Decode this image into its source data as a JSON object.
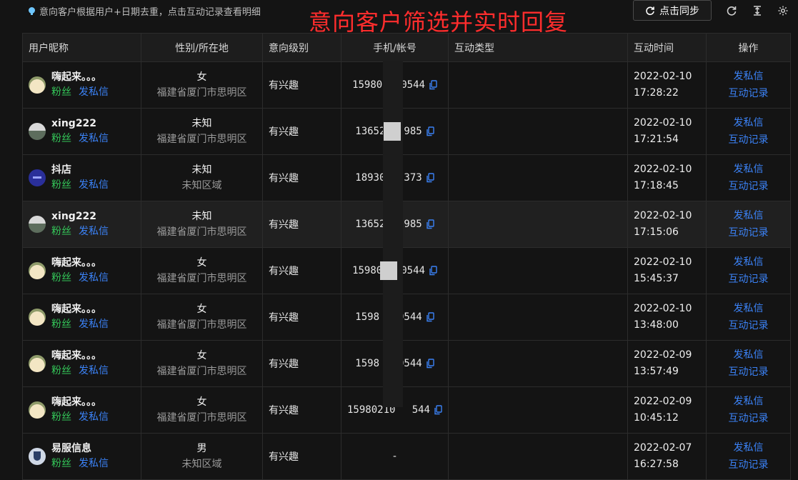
{
  "toolbar": {
    "hint": "意向客户根据用户+日期去重，点击互动记录查看明细",
    "overlay_title": "意向客户筛选并实时回复",
    "sync_label": "点击同步",
    "icons": [
      "refresh-icon",
      "column-height-icon",
      "gear-icon"
    ]
  },
  "table": {
    "headers": {
      "nickname": "用户昵称",
      "gender_region": "性别/所在地",
      "intent_level": "意向级别",
      "phone": "手机/帐号",
      "interaction_type": "互动类型",
      "interaction_time": "互动时间",
      "actions": "操作"
    },
    "rows": [
      {
        "nickname": "嗨起来。。。",
        "tag": "粉丝",
        "dm": "发私信",
        "gender": "女",
        "region": "福建省厦门市思明区",
        "level": "有兴趣",
        "phone_left": "15980",
        "phone_right": "0544",
        "type": "",
        "date": "2022-02-10",
        "time": "17:28:22",
        "op1": "发私信",
        "op2": "互动记录",
        "avatar": "totoro"
      },
      {
        "nickname": "xing222",
        "tag": "粉丝",
        "dm": "发私信",
        "gender": "未知",
        "region": "福建省厦门市思明区",
        "level": "有兴趣",
        "phone_left": "13652",
        "phone_right": "985",
        "type": "",
        "date": "2022-02-10",
        "time": "17:21:54",
        "op1": "发私信",
        "op2": "互动记录",
        "avatar": "landscape"
      },
      {
        "nickname": "抖店",
        "tag": "粉丝",
        "dm": "发私信",
        "gender": "未知",
        "region": "未知区域",
        "level": "有兴趣",
        "phone_left": "18930",
        "phone_right": "373",
        "type": "",
        "date": "2022-02-10",
        "time": "17:18:45",
        "op1": "发私信",
        "op2": "互动记录",
        "avatar": "store"
      },
      {
        "nickname": "xing222",
        "tag": "粉丝",
        "dm": "发私信",
        "gender": "未知",
        "region": "福建省厦门市思明区",
        "level": "有兴趣",
        "phone_left": "13652",
        "phone_right": "985",
        "type": "",
        "date": "2022-02-10",
        "time": "17:15:06",
        "op1": "发私信",
        "op2": "互动记录",
        "avatar": "landscape"
      },
      {
        "nickname": "嗨起来。。。",
        "tag": "粉丝",
        "dm": "发私信",
        "gender": "女",
        "region": "福建省厦门市思明区",
        "level": "有兴趣",
        "phone_left": "15980",
        "phone_right": "0544",
        "type": "",
        "date": "2022-02-10",
        "time": "15:45:37",
        "op1": "发私信",
        "op2": "互动记录",
        "avatar": "totoro"
      },
      {
        "nickname": "嗨起来。。。",
        "tag": "粉丝",
        "dm": "发私信",
        "gender": "女",
        "region": "福建省厦门市思明区",
        "level": "有兴趣",
        "phone_left": "1598",
        "phone_right": "0544",
        "type": "",
        "date": "2022-02-10",
        "time": "13:48:00",
        "op1": "发私信",
        "op2": "互动记录",
        "avatar": "totoro"
      },
      {
        "nickname": "嗨起来。。。",
        "tag": "粉丝",
        "dm": "发私信",
        "gender": "女",
        "region": "福建省厦门市思明区",
        "level": "有兴趣",
        "phone_left": "1598",
        "phone_right": "0544",
        "type": "",
        "date": "2022-02-09",
        "time": "13:57:49",
        "op1": "发私信",
        "op2": "互动记录",
        "avatar": "totoro"
      },
      {
        "nickname": "嗨起来。。。",
        "tag": "粉丝",
        "dm": "发私信",
        "gender": "女",
        "region": "福建省厦门市思明区",
        "level": "有兴趣",
        "phone_left": "15980210",
        "phone_right": "544",
        "type": "",
        "date": "2022-02-09",
        "time": "10:45:12",
        "op1": "发私信",
        "op2": "互动记录",
        "avatar": "totoro"
      },
      {
        "nickname": "易服信息",
        "tag": "粉丝",
        "dm": "发私信",
        "gender": "男",
        "region": "未知区域",
        "level": "有兴趣",
        "phone_left": "-",
        "phone_right": "",
        "type": "",
        "date": "2022-02-07",
        "time": "16:27:58",
        "op1": "发私信",
        "op2": "互动记录",
        "avatar": "shield"
      }
    ]
  },
  "colors": {
    "background": "#141414",
    "accent_link": "#3b82f6",
    "fans_green": "#34c759",
    "overlay_red": "#ff2d2d"
  }
}
